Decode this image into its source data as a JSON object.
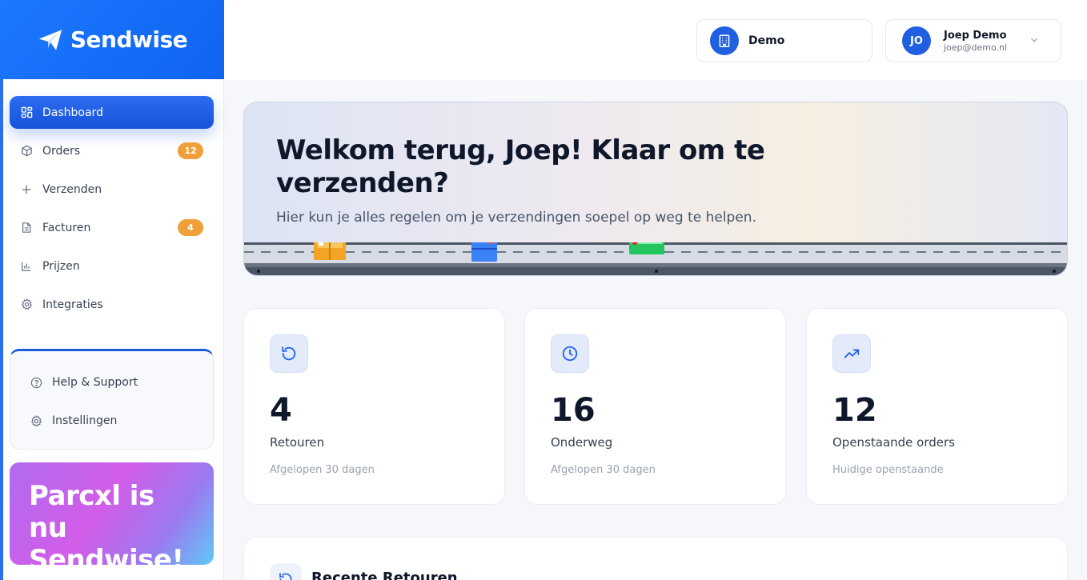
{
  "brand": {
    "name": "Sendwise"
  },
  "sidebar": {
    "items": [
      {
        "label": "Dashboard",
        "icon": "grid-icon",
        "active": true
      },
      {
        "label": "Orders",
        "icon": "box-icon",
        "badge": "12"
      },
      {
        "label": "Verzenden",
        "icon": "plus-icon"
      },
      {
        "label": "Facturen",
        "icon": "document-icon",
        "badge": "4"
      },
      {
        "label": "Prijzen",
        "icon": "bar-chart-icon"
      },
      {
        "label": "Integraties",
        "icon": "gear-icon"
      }
    ],
    "support": [
      {
        "label": "Help & Support",
        "icon": "help-circle-icon"
      },
      {
        "label": "Instellingen",
        "icon": "gear-icon"
      }
    ],
    "promo": "Parcxl is nu Sendwise!"
  },
  "header": {
    "org": {
      "name": "Demo",
      "icon": "building-icon"
    },
    "user": {
      "initials": "JO",
      "name": "Joep Demo",
      "email": "joep@demo.nl"
    }
  },
  "hero": {
    "title": "Welkom terug, Joep! Klaar om te verzenden?",
    "subtitle": "Hier kun je alles regelen om je verzendingen soepel op weg te helpen."
  },
  "stats": [
    {
      "value": "4",
      "label": "Retouren",
      "sub": "Afgelopen 30 dagen",
      "icon": "refresh-icon"
    },
    {
      "value": "16",
      "label": "Onderweg",
      "sub": "Afgelopen 30 dagen",
      "icon": "clock-icon"
    },
    {
      "value": "12",
      "label": "Openstaande orders",
      "sub": "Huidige openstaande",
      "icon": "trending-up-icon"
    }
  ],
  "recent": {
    "title": "Recente Retouren",
    "icon": "refresh-icon"
  },
  "colors": {
    "primary": "#1f5fe0",
    "badge": "#f0a03a"
  }
}
